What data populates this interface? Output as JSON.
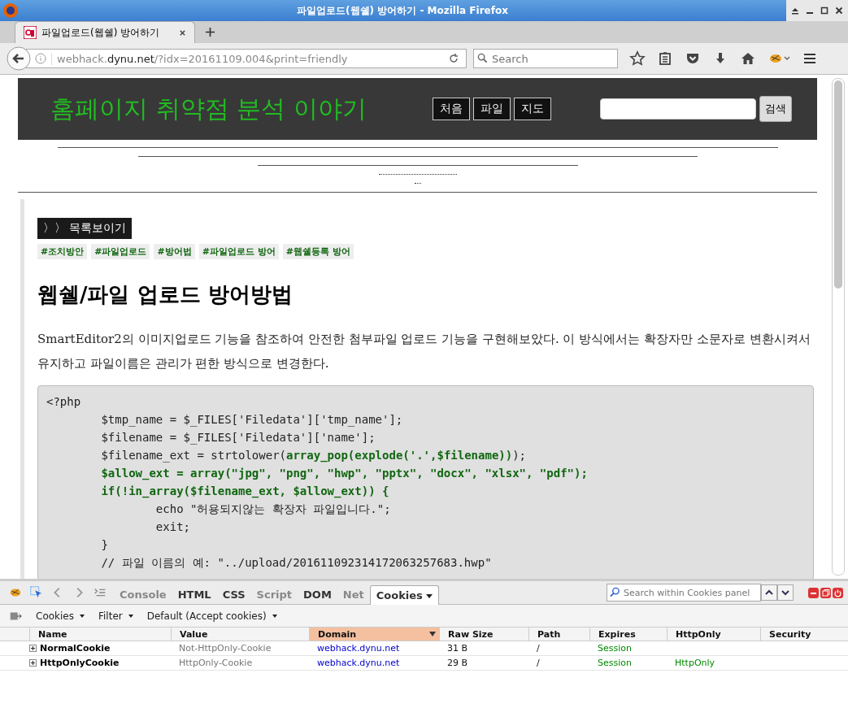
{
  "window": {
    "title": "파일업로드(웹쉘) 방어하기 - Mozilla Firefox"
  },
  "tabs": [
    {
      "label": "파일업로드(웹쉘) 방어하기",
      "selected": true
    }
  ],
  "address_bar": {
    "host_prefix": "webhack.",
    "host": "dynu.net",
    "path": "/?idx=20161109.004&print=friendly"
  },
  "search": {
    "placeholder": "Search"
  },
  "site": {
    "title": "홈페이지 취약점 분석 이야기",
    "nav": [
      "처음",
      "파일",
      "지도"
    ],
    "search_button": "검색"
  },
  "article": {
    "list_button": "〉〉 목록보이기",
    "tags": [
      "#조치방안",
      "#파일업로드",
      "#방어법",
      "#파일업로드 방어",
      "#웹쉘등록 방어"
    ],
    "heading": "웹쉘/파일 업로드 방어방법",
    "paragraph": "SmartEditor2의 이미지업로드 기능을 참조하여 안전한 첨부파일 업로드 기능을 구현해보았다. 이 방식에서는 확장자만 소문자로 변환시켜서 유지하고 파일이름은 관리가 편한 방식으로 변경한다.",
    "code": [
      [
        {
          "text": "<?php",
          "kind": "plain"
        }
      ],
      [
        {
          "text": "        $tmp_name = $_FILES['Filedata']['tmp_name'];",
          "kind": "plain"
        }
      ],
      [
        {
          "text": "        $filename = $_FILES['Filedata']['name'];",
          "kind": "plain"
        }
      ],
      [
        {
          "text": "        $filename_ext = strtolower(",
          "kind": "plain"
        },
        {
          "text": "array_pop(explode('.',$filename))",
          "kind": "keyword"
        },
        {
          "text": ");",
          "kind": "plain"
        }
      ],
      [
        {
          "text": "        $allow_ext = array(\"jpg\", \"png\", \"hwp\", \"pptx\", \"docx\", \"xlsx\", \"pdf\");",
          "kind": "keyword"
        }
      ],
      [
        {
          "text": "        if(!in_array($filename_ext, $allow_ext)) {",
          "kind": "keyword"
        }
      ],
      [
        {
          "text": "                echo \"허용되지않는 확장자 파일입니다.\";",
          "kind": "plain"
        }
      ],
      [
        {
          "text": "                exit;",
          "kind": "plain"
        }
      ],
      [
        {
          "text": "        }",
          "kind": "plain"
        }
      ],
      [
        {
          "text": "        // 파일 이름의 예: \"../upload/201611092314172063257683.hwp\"",
          "kind": "plain"
        }
      ]
    ]
  },
  "devtools": {
    "tabs": [
      {
        "label": "Console",
        "selected": false,
        "disabled": true
      },
      {
        "label": "HTML",
        "selected": false,
        "disabled": false
      },
      {
        "label": "CSS",
        "selected": false,
        "disabled": false
      },
      {
        "label": "Script",
        "selected": false,
        "disabled": true
      },
      {
        "label": "DOM",
        "selected": false,
        "disabled": false
      },
      {
        "label": "Net",
        "selected": false,
        "disabled": true
      },
      {
        "label": "Cookies",
        "selected": true,
        "disabled": false
      }
    ],
    "search": {
      "placeholder": "Search within Cookies panel"
    },
    "menus": [
      "Cookies",
      "Filter",
      "Default (Accept cookies)"
    ],
    "columns": [
      {
        "label": "Name",
        "kind": "name",
        "sorted": false
      },
      {
        "label": "Value",
        "kind": "value",
        "sorted": false
      },
      {
        "label": "Domain",
        "kind": "link",
        "sorted": true
      },
      {
        "label": "Raw Size",
        "kind": "text",
        "sorted": false
      },
      {
        "label": "Path",
        "kind": "text",
        "sorted": false
      },
      {
        "label": "Expires",
        "kind": "green",
        "sorted": false
      },
      {
        "label": "HttpOnly",
        "kind": "green",
        "sorted": false
      },
      {
        "label": "Security",
        "sorted": false
      }
    ],
    "rows": [
      [
        "NormalCookie",
        "Not-HttpOnly-Cookie",
        "webhack.dynu.net",
        "31 B",
        "/",
        "Session",
        "",
        ""
      ],
      [
        "HttpOnlyCookie",
        "HttpOnly-Cookie",
        "webhack.dynu.net",
        "29 B",
        "/",
        "Session",
        "HttpOnly",
        ""
      ]
    ]
  }
}
